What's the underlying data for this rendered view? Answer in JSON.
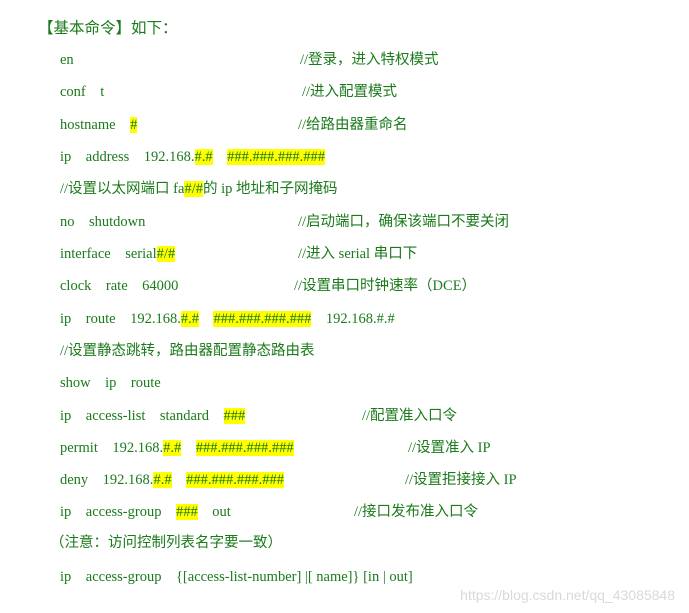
{
  "title": "【基本命令】如下：",
  "lines": [
    {
      "cmd": [
        "en"
      ],
      "comment": "//登录，进入特权模式"
    },
    {
      "cmd": [
        "conf　t"
      ],
      "comment": "//进入配置模式"
    },
    {
      "cmd": [
        "hostname　",
        {
          "hl": "#"
        }
      ],
      "comment": "//给路由器重命名"
    },
    {
      "cmd": [
        "ip　address　192.168.",
        {
          "hl": "#.#"
        },
        "　",
        {
          "hl": "###.###.###.###"
        }
      ],
      "comment": ""
    },
    {
      "cmd": [
        "//设置以太网端口 fa",
        {
          "hl": "#/#"
        },
        "的 ip 地址和子网掩码"
      ],
      "comment": ""
    },
    {
      "cmd": [
        "no　shutdown"
      ],
      "comment": "//启动端口，确保该端口不要关闭"
    },
    {
      "cmd": [
        "interface　serial",
        {
          "hl": "#/#"
        }
      ],
      "comment": "//进入 serial 串口下"
    },
    {
      "cmd": [
        "clock　rate　64000"
      ],
      "comment": "//设置串口时钟速率（DCE）"
    },
    {
      "cmd": [
        "ip　route　192.168.",
        {
          "hl": "#.#"
        },
        "　",
        {
          "hl": "###.###.###.###"
        },
        "　192.168.#.#"
      ],
      "comment": ""
    },
    {
      "cmd": [
        "//设置静态跳转，路由器配置静态路由表"
      ],
      "comment": ""
    },
    {
      "cmd": [
        "show　ip　route"
      ],
      "comment": ""
    },
    {
      "cmd": [
        "ip　access-list　standard　",
        {
          "hl": "###"
        }
      ],
      "comment": "//配置准入口令"
    },
    {
      "cmd": [
        "permit　192.168.",
        {
          "hl": "#.#"
        },
        "　",
        {
          "hl": "###.###.###.###"
        }
      ],
      "comment": "//设置准入 IP"
    },
    {
      "cmd": [
        "deny　192.168.",
        {
          "hl": "#.#"
        },
        "　",
        {
          "hl": "###.###.###.###"
        }
      ],
      "comment": "//设置拒接接入 IP"
    },
    {
      "cmd": [
        "ip　access-group　",
        {
          "hl": "###"
        },
        "　out"
      ],
      "comment": "//接口发布准入口令"
    },
    {
      "cmd": [
        "（注意：访问控制列表名字要一致）"
      ],
      "comment": ""
    },
    {
      "cmd": [
        "ip　access-group　{[access-list-number] |[ name]} [in | out]"
      ],
      "comment": ""
    }
  ],
  "watermark": "https://blog.csdn.net/qq_43085848"
}
